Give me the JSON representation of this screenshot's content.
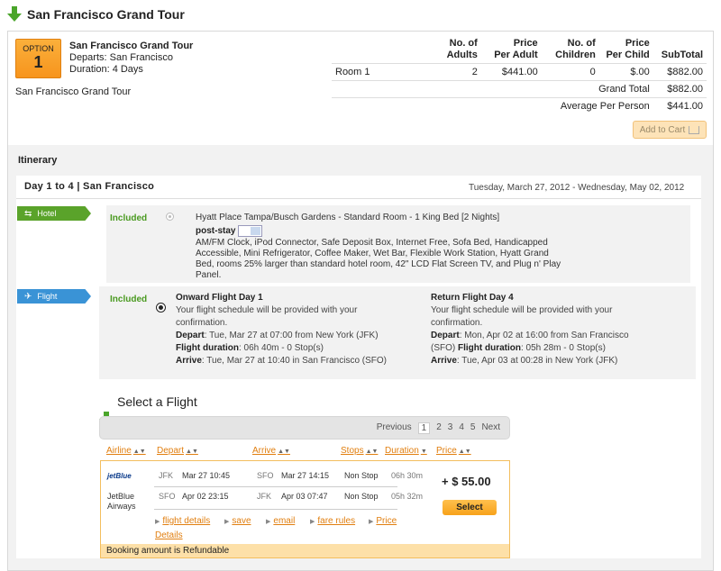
{
  "header": {
    "title": "San Francisco Grand Tour"
  },
  "package": {
    "option_label": "OPTION",
    "option_number": "1",
    "name": "San Francisco Grand Tour",
    "departs": "Departs: San Francisco",
    "duration": "Duration: 4 Days",
    "subtitle": "San Francisco Grand Tour"
  },
  "price_table": {
    "headers": [
      "No. of Adults",
      "Price Per Adult",
      "No. of Children",
      "Price Per Child",
      "SubTotal"
    ],
    "header_lines": [
      [
        "",
        "No. of",
        "Price",
        "No. of",
        "Price",
        ""
      ],
      [
        "",
        "Adults",
        "Per Adult",
        "Children",
        "Per Child",
        "SubTotal"
      ]
    ],
    "room": {
      "name": "Room 1",
      "adults": "2",
      "price_adult": "$441.00",
      "children": "0",
      "price_child": "$.00",
      "subtotal": "$882.00"
    },
    "grand_total_label": "Grand Total",
    "grand_total": "$882.00",
    "avg_label": "Average Per Person",
    "avg": "$441.00"
  },
  "add_to_cart": "Add to Cart",
  "itinerary": {
    "label": "Itinerary",
    "day_title": "Day 1 to 4  |  San Francisco",
    "day_date": "Tuesday, March 27, 2012 - Wednesday, May 02, 2012",
    "hotel": {
      "tag": "Hotel",
      "included": "Included",
      "name": "Hyatt Place Tampa/Busch Gardens - Standard Room - 1 King Bed [2 Nights]",
      "stay_label": "post-stay",
      "desc_lines": [
        "AM/FM Clock, iPod Connector, Safe Deposit Box, Internet Free, Sofa Bed, Handicapped",
        "Accessible, Mini Refrigerator, Coffee Maker, Wet Bar, Flexible Work Station, Hyatt Grand",
        "Bed, rooms 25% larger than standard hotel room, 42\" LCD Flat Screen TV, and Plug n' Play",
        "Panel."
      ]
    },
    "flight": {
      "tag": "Flight",
      "included": "Included",
      "onward": {
        "title": "Onward Flight Day 1",
        "note1": "Your flight schedule will be provided with your",
        "note2": "confirmation.",
        "depart_label": "Depart",
        "depart": ": Tue, Mar 27 at 07:00 from New York (JFK)",
        "duration_label": "Flight duration",
        "duration": ": 06h 40m - 0 Stop(s)",
        "arrive_label": "Arrive",
        "arrive": ": Tue, Mar 27 at 10:40 in San Francisco (SFO)"
      },
      "return": {
        "title": "Return Flight Day 4",
        "note1": "Your flight schedule will be provided with your",
        "note2": "confirmation.",
        "depart_label": "Depart",
        "depart": ": Mon, Apr 02 at 16:00 from San Francisco",
        "depart2": "(SFO)",
        "duration_label": "Flight duration",
        "duration": ": 05h 28m - 0 Stop(s)",
        "arrive_label": "Arrive",
        "arrive": ": Tue, Apr 03 at 00:28  in New York (JFK)"
      }
    }
  },
  "select_flight": {
    "title": "Select a Flight",
    "pager": {
      "previous": "Previous",
      "pages": [
        "1",
        "2",
        "3",
        "4",
        "5"
      ],
      "next": "Next"
    },
    "columns": {
      "airline": "Airline",
      "depart": "Depart",
      "arrive": "Arrive",
      "stops": "Stops",
      "duration": "Duration",
      "price": "Price"
    },
    "result": {
      "logo": "jetBlue",
      "airline": "JetBlue Airways",
      "airline_l1": "JetBlue",
      "airline_l2": "Airways",
      "leg1": {
        "from": "JFK",
        "dep": "Mar 27 10:45",
        "to": "SFO",
        "arr": "Mar 27 14:15",
        "stops": "Non Stop",
        "dur": "06h 30m"
      },
      "leg2": {
        "from": "SFO",
        "dep": "Apr 02 23:15",
        "to": "JFK",
        "arr": "Apr 03 07:47",
        "stops": "Non Stop",
        "dur": "05h 32m"
      },
      "price": "+ $ 55.00",
      "select": "Select",
      "links": {
        "flight_details": "flight details",
        "save": "save",
        "email": "email",
        "fare_rules": "fare rules",
        "price": "Price",
        "details": "Details"
      },
      "refund": "Booking amount is Refundable"
    }
  },
  "colors": {
    "accent": "#f7941d",
    "link": "#e17f10",
    "hotel_tag": "#5aa32a",
    "flight_tag": "#3a93d6",
    "included": "#4a9a20"
  }
}
